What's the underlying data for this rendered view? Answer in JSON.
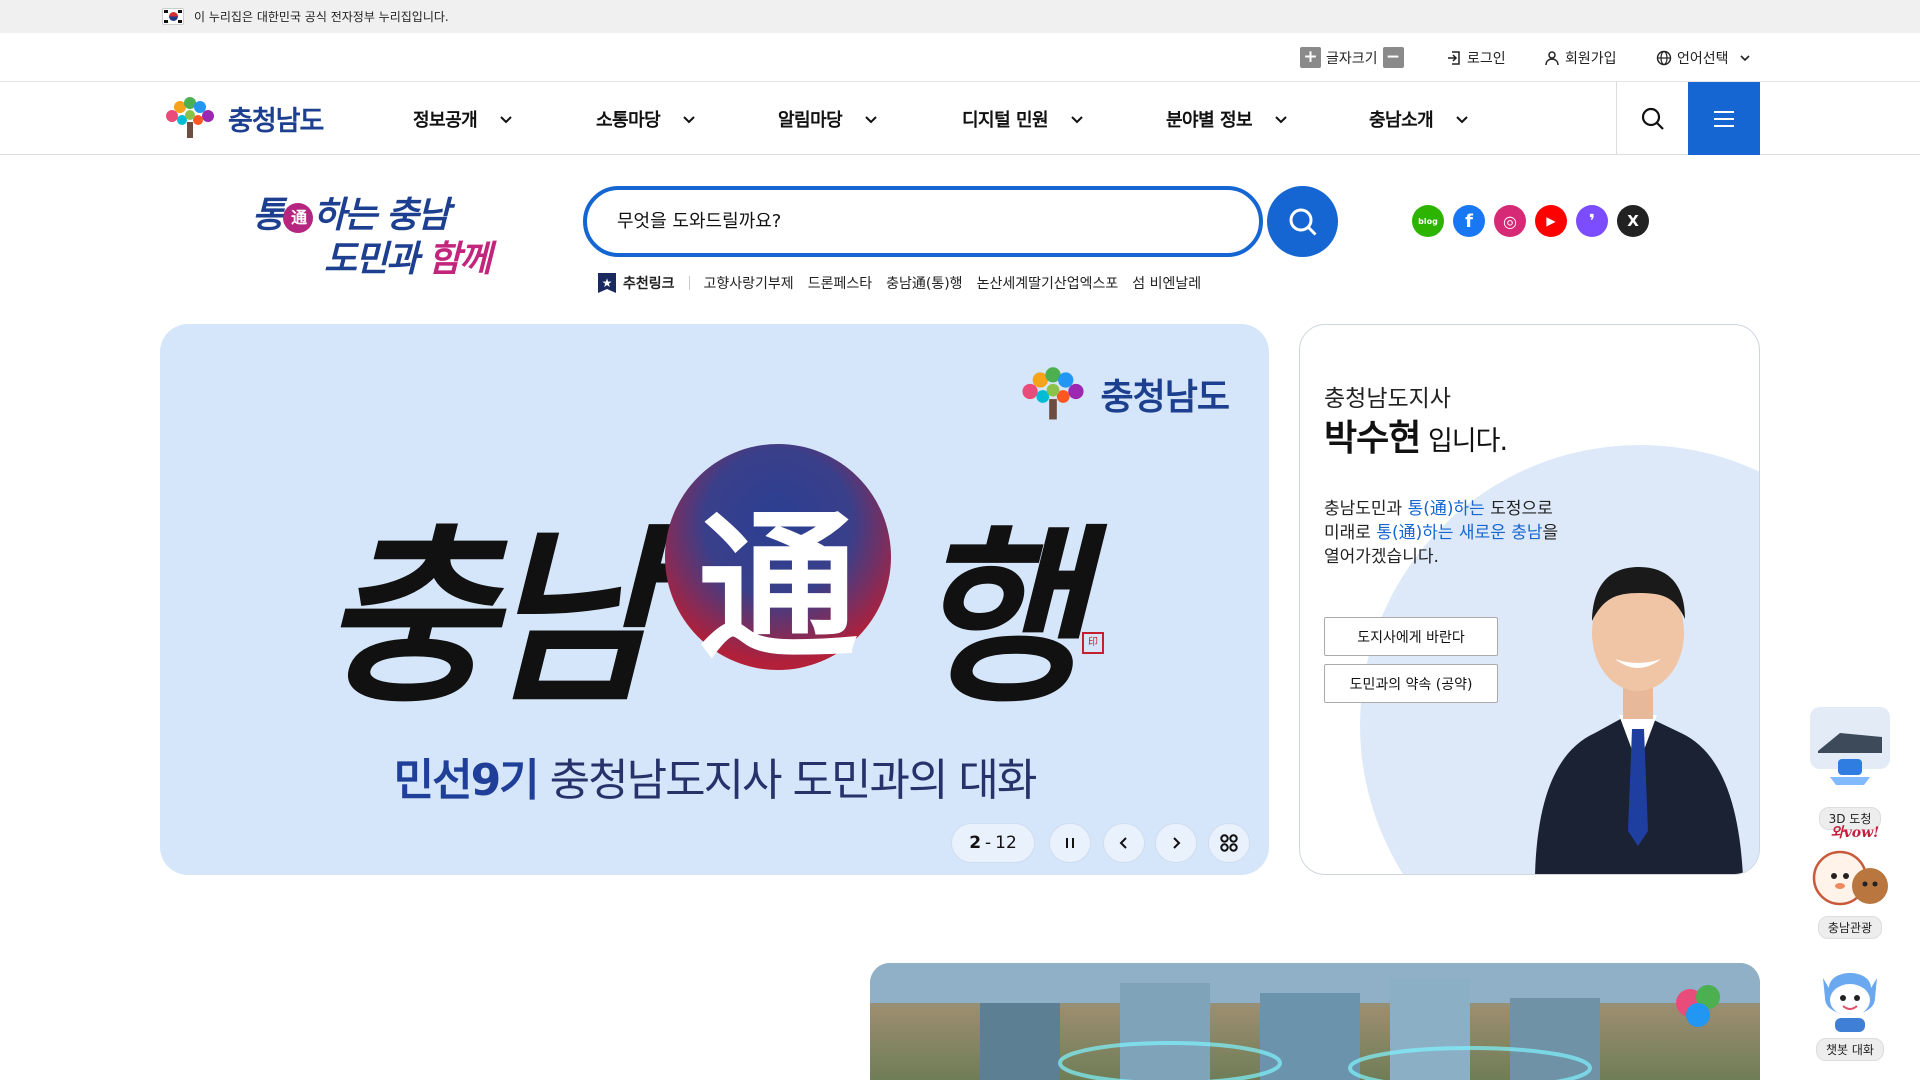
{
  "gov_banner": {
    "text": "이 누리집은 대한민국 공식 전자정부 누리집입니다."
  },
  "util": {
    "font_size": "글자크기",
    "login": "로그인",
    "signup": "회원가입",
    "language": "언어선택"
  },
  "nav": {
    "logo": "충청남도",
    "menus": [
      "정보공개",
      "소통마당",
      "알림마당",
      "디지털 민원",
      "분야별 정보",
      "충남소개"
    ]
  },
  "slogan": {
    "line1_a": "통",
    "line1_badge": "通",
    "line1_b": "하는 충남",
    "line2_a": "도민과 ",
    "line2_b": "함께"
  },
  "search": {
    "placeholder": "무엇을 도와드릴까요?"
  },
  "recommend": {
    "title": "추천링크",
    "links": [
      "고향사랑기부제",
      "드론페스타",
      "충남通(통)행",
      "논산세계딸기산업엑스포",
      "섬 비엔날레"
    ]
  },
  "sns": [
    {
      "name": "blog",
      "label": "blog",
      "color": "#2db400"
    },
    {
      "name": "facebook",
      "label": "f",
      "color": "#1877f2"
    },
    {
      "name": "instagram",
      "label": "◎",
      "color": "#d62976"
    },
    {
      "name": "youtube",
      "label": "▶",
      "color": "#ff0000"
    },
    {
      "name": "talk",
      "label": "❜",
      "color": "#7b4dff"
    },
    {
      "name": "x",
      "label": "X",
      "color": "#222222"
    }
  ],
  "hero": {
    "brand": "충청남도",
    "big_left": "충남",
    "big_center": "通",
    "big_right": "행",
    "subtitle_highlight": "민선9기",
    "subtitle_rest": " 충청남도지사 도민과의 대화",
    "page_current": "2",
    "page_sep": "-",
    "page_total": "12"
  },
  "governor": {
    "title": "충청남도지사",
    "name": "박수현",
    "name_suffix": " 입니다.",
    "desc_1": "충남도민과 ",
    "desc_2": "통(通)하는",
    "desc_3": " 도정으로",
    "desc_4": "미래로 ",
    "desc_5": "통(通)하는 새로운 충남",
    "desc_6": "을",
    "desc_7": "열어가겠습니다.",
    "btn_1": "도지사에게 바란다",
    "btn_2": "도민과의 약속 (공약)"
  },
  "float": {
    "item_1": "3D 도청",
    "item_2": "충남관광",
    "item_2_tag": "와vow!",
    "item_3": "챗봇 대화"
  },
  "colors": {
    "primary": "#1566d2",
    "brand_navy": "#1d3f8f",
    "hero_bg": "#d6e6fa"
  }
}
